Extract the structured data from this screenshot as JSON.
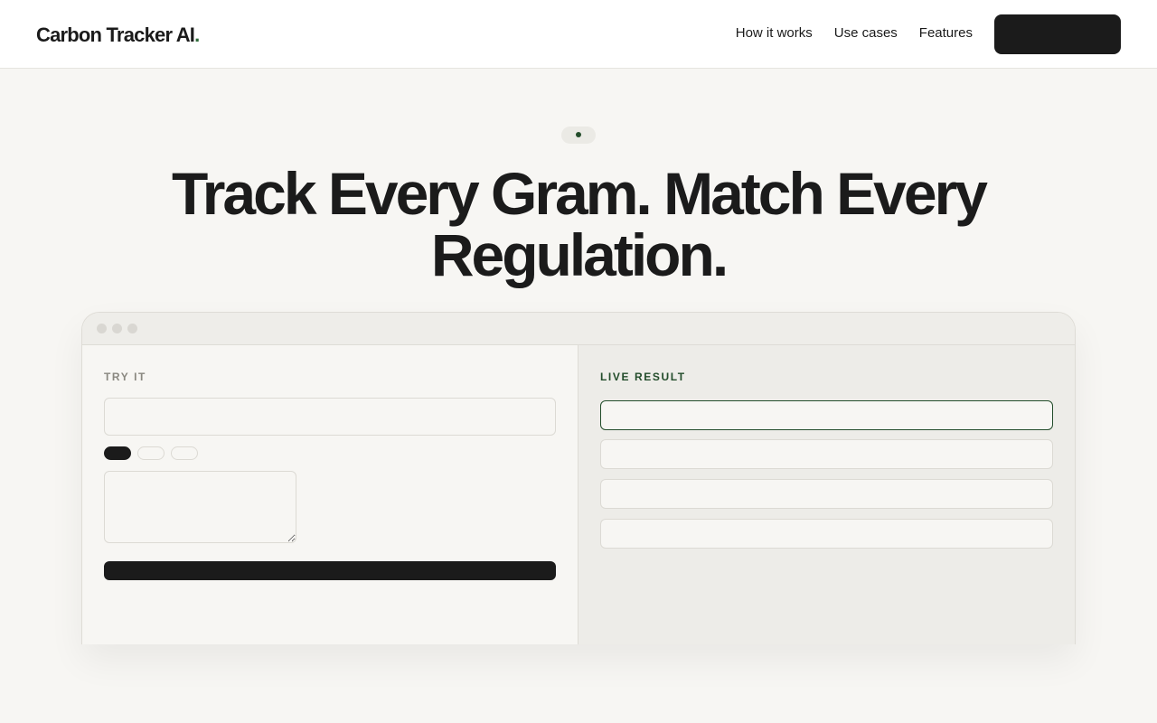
{
  "header": {
    "logo_text": "Carbon Tracker AI",
    "logo_dot": ".",
    "nav": [
      "How it works",
      "Use cases",
      "Features"
    ],
    "cta_label": ""
  },
  "hero": {
    "badge_text": "",
    "headline": "Track Every Gram. Match Every Regulation."
  },
  "demo": {
    "left_label": "TRY IT",
    "right_label": "LIVE RESULT",
    "input_placeholder": "",
    "textarea_placeholder": "",
    "run_button_label": "",
    "chips": [
      "",
      "",
      ""
    ],
    "results": [
      "",
      "",
      "",
      ""
    ]
  },
  "colors": {
    "accent": "#234d2b",
    "dark": "#1b1b1b",
    "background": "#f7f6f3"
  }
}
